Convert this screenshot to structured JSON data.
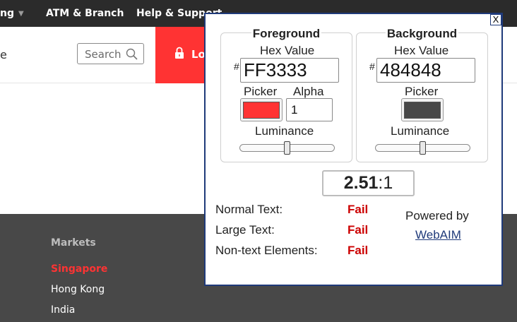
{
  "nav": {
    "partial_item": "ng",
    "atm_branch": "ATM & Branch",
    "help_support": "Help & Support"
  },
  "subbar": {
    "partial_text": "e",
    "search_placeholder": "Search",
    "login_partial": "Lo"
  },
  "footer": {
    "heading": "Markets",
    "links": [
      "Singapore",
      "Hong Kong",
      "India"
    ]
  },
  "checker": {
    "close_label": "X",
    "foreground": {
      "title": "Foreground",
      "hex_label": "Hex Value",
      "hash": "#",
      "hex_value": "FF3333",
      "picker_label": "Picker",
      "alpha_label": "Alpha",
      "alpha_value": "1",
      "luminance_label": "Luminance",
      "swatch_color": "#ff3333",
      "luminance_level": 0.5
    },
    "background": {
      "title": "Background",
      "hex_label": "Hex Value",
      "hash": "#",
      "hex_value": "484848",
      "picker_label": "Picker",
      "luminance_label": "Luminance",
      "swatch_color": "#484848",
      "luminance_level": 0.5
    },
    "ratio": {
      "value": "2.51",
      "suffix": ":1"
    },
    "results": [
      {
        "label": "Normal Text:",
        "value": "Fail"
      },
      {
        "label": "Large Text:",
        "value": "Fail"
      },
      {
        "label": "Non-text Elements:",
        "value": "Fail"
      }
    ],
    "powered_by": "Powered by",
    "webaim_link": "WebAIM"
  },
  "colors": {
    "brand_red": "#ff3333",
    "nav_bg": "#2b2b2b",
    "footer_bg": "#484848",
    "fail_red": "#cc0000",
    "popup_border": "#1f3a7a"
  }
}
